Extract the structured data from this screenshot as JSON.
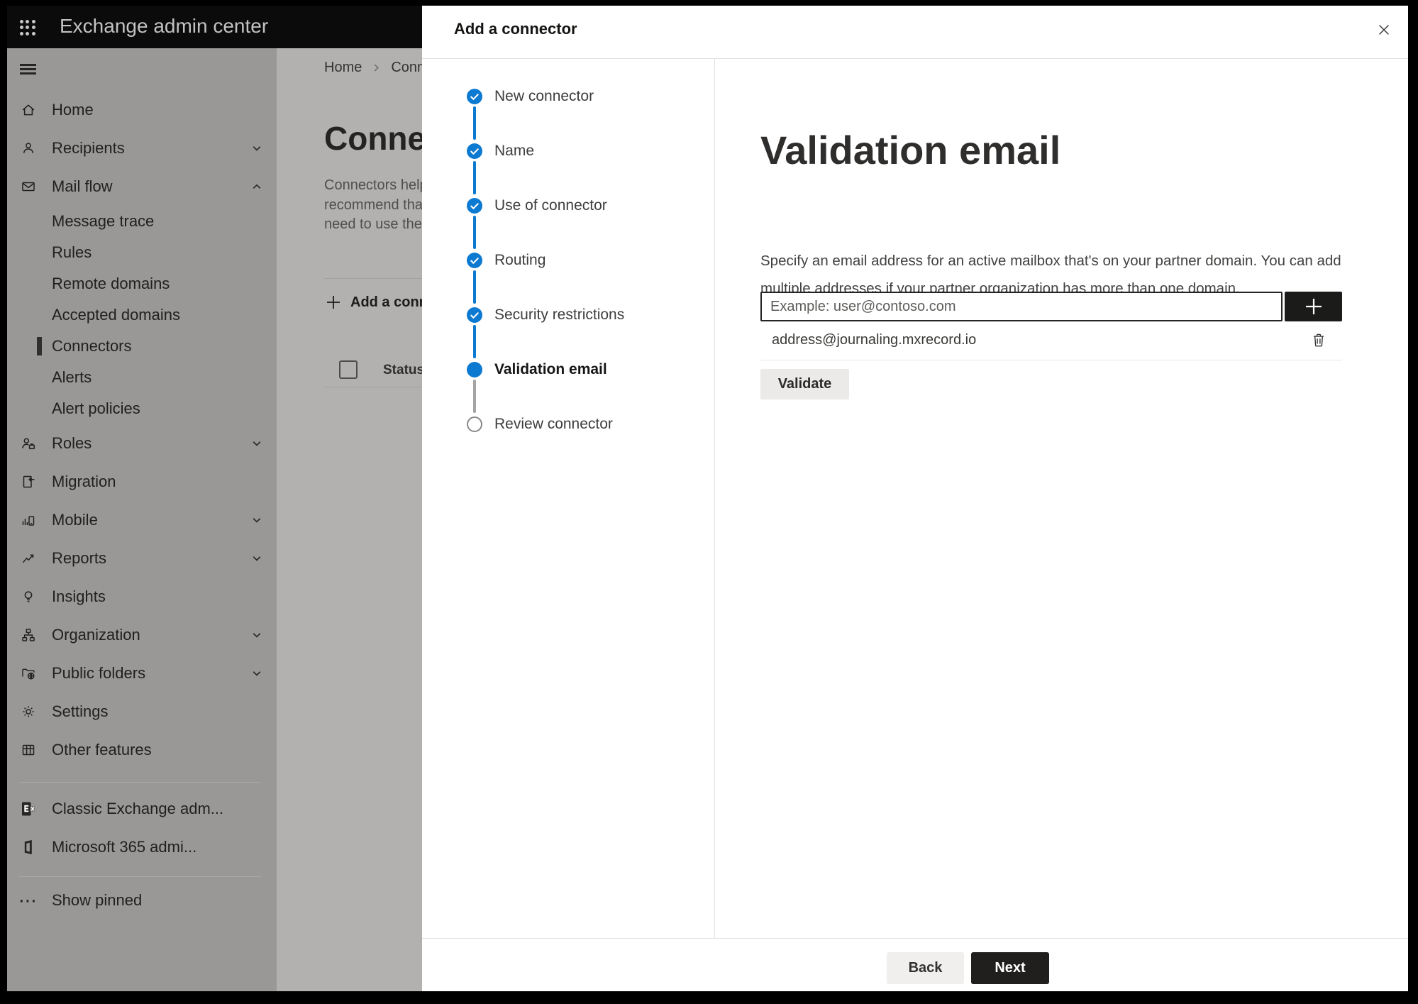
{
  "top_bar": {
    "title": "Exchange admin center"
  },
  "sidebar": {
    "items": [
      {
        "label": "Home"
      },
      {
        "label": "Recipients",
        "chevron": "down"
      },
      {
        "label": "Mail flow",
        "chevron": "up",
        "expanded": true
      },
      {
        "label": "Message trace",
        "indent": true
      },
      {
        "label": "Rules",
        "indent": true
      },
      {
        "label": "Remote domains",
        "indent": true
      },
      {
        "label": "Accepted domains",
        "indent": true
      },
      {
        "label": "Connectors",
        "indent": true,
        "selected": true
      },
      {
        "label": "Alerts",
        "indent": true
      },
      {
        "label": "Alert policies",
        "indent": true
      },
      {
        "label": "Roles",
        "chevron": "down"
      },
      {
        "label": "Migration"
      },
      {
        "label": "Mobile",
        "chevron": "down"
      },
      {
        "label": "Reports",
        "chevron": "down"
      },
      {
        "label": "Insights"
      },
      {
        "label": "Organization",
        "chevron": "down"
      },
      {
        "label": "Public folders",
        "chevron": "down"
      },
      {
        "label": "Settings"
      },
      {
        "label": "Other features"
      }
    ],
    "footer_items": [
      {
        "label": "Classic Exchange adm..."
      },
      {
        "label": "Microsoft 365 admi..."
      }
    ],
    "show_pinned_label": "Show pinned"
  },
  "page": {
    "breadcrumb": [
      "Home",
      "Conne"
    ],
    "heading": "Connec",
    "description_lines": [
      "Connectors help",
      "recommend tha",
      "need to use ther"
    ],
    "add_button_label": "Add a conn",
    "status_header": "Status"
  },
  "modal": {
    "title": "Add a connector",
    "steps": [
      {
        "label": "New connector",
        "state": "completed"
      },
      {
        "label": "Name",
        "state": "completed"
      },
      {
        "label": "Use of connector",
        "state": "completed"
      },
      {
        "label": "Routing",
        "state": "completed"
      },
      {
        "label": "Security restrictions",
        "state": "completed"
      },
      {
        "label": "Validation email",
        "state": "current"
      },
      {
        "label": "Review connector",
        "state": "upcoming"
      }
    ],
    "content": {
      "heading": "Validation email",
      "description": "Specify an email address for an active mailbox that's on your partner domain. You can add multiple addresses if your partner organization has more than one domain.",
      "email_input_placeholder": "Example: user@contoso.com",
      "addresses": [
        "address@journaling.mxrecord.io"
      ],
      "validate_button_label": "Validate"
    },
    "footer": {
      "back_label": "Back",
      "next_label": "Next"
    }
  },
  "icons": {
    "app_launcher": "3x3-dot-grid",
    "nav_menu": "hamburger",
    "step_completed": "blue-circle-check",
    "step_current": "blue-circle-solid",
    "step_upcoming": "gray-circle-outline",
    "add_address": "plus",
    "remove_address": "trash",
    "close_dialog": "x"
  },
  "colors": {
    "accent_blue": "#0d7ad1",
    "dark_button": "#1b1b1a",
    "topbar": "#0b0b0b",
    "modal_bg": "#ffffff",
    "divider": "#e3e1df"
  }
}
